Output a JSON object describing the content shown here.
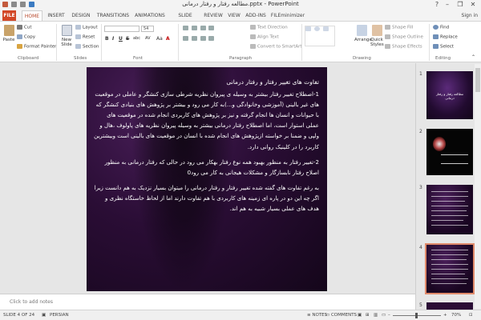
{
  "window": {
    "title": "مطالعه رفتار و رفتار درمانی.pptx - PowerPoint",
    "controls": {
      "help": "?",
      "minimize": "–",
      "restore": "❐",
      "close": "✕"
    }
  },
  "tabs": [
    "FILE",
    "HOME",
    "INSERT",
    "DESIGN",
    "TRANSITIONS",
    "ANIMATIONS",
    "SLIDE SHOW",
    "REVIEW",
    "VIEW",
    "ADD-INS",
    "FILEminimizer"
  ],
  "active_tab": "HOME",
  "signin": "Sign in",
  "ribbon": {
    "clipboard": {
      "paste": "Paste",
      "cut": "Cut",
      "copy": "Copy",
      "format_painter": "Format Painter",
      "label": "Clipboard"
    },
    "slides": {
      "new_slide_1": "New",
      "new_slide_2": "Slide",
      "layout": "Layout",
      "reset": "Reset",
      "section": "Section",
      "label": "Slides"
    },
    "font": {
      "name": "",
      "size": "54",
      "bold": "B",
      "italic": "I",
      "underline": "U",
      "strike": "S",
      "shadow": "abc",
      "spacing": "AV",
      "case": "Aa",
      "color": "A",
      "label": "Font"
    },
    "paragraph": {
      "text_direction": "Text Direction",
      "align_text": "Align Text",
      "smartart": "Convert to SmartArt",
      "label": "Paragraph"
    },
    "drawing": {
      "arrange": "Arrange",
      "quick_styles_1": "Quick",
      "quick_styles_2": "Styles",
      "shape_fill": "Shape Fill",
      "shape_outline": "Shape Outline",
      "shape_effects": "Shape Effects",
      "label": "Drawing"
    },
    "editing": {
      "find": "Find",
      "replace": "Replace",
      "select": "Select",
      "label": "Editing"
    }
  },
  "slide": {
    "heading": "تفاوت های تغییر رفتار و رفتار درمانی",
    "paragraphs": [
      "1-اصطلاح تغییر رفتار بیشتر به وسیله ی پیروان نظریه شرطی سازی کنشگر و عاملی در موقعیت های غیر بالینی (آموزشی وخانوادگی و...)به کار می رود و بیشتر بر پژوهش های بنیادی کنشگر که با حیوانات و انسان ها انجام گرفته و نیز بر پژوهش های کاربردی انجام شده در موقعیت های عملی استوار است، اما اصطلاح رفتار درمانی بیشتر به وسیله پیروان نظریه های پاولوف ،هال و ولپی و ضمنا بر خواسته ازپژوهش های انجام شده با انسان در موقعیت های بالینی است وبیشترین کاربرد را در کلینیک روانی دارد.",
      "2-تغییر رفتار به منظور بهبود همه نوع رفتار بهکار می رود در حالی که رفتار درمانی به منظور اصلاح رفتار نابسازگار و مشکلات هیجانی به کار می رود0",
      "به رغم تفاوت های گفته شده تغییر رفتار و رفتار درمانی را میتوان بسیار نزدیک به هم دانست زیرا اگر چه این دو در پاره ای زمینه های کاربردی با هم تفاوت دارند اما از لحاظ خاستگاه نظری و هدف های عملی بسیار شبیه به هم اند."
    ]
  },
  "thumbnails": [
    {
      "num": "1",
      "star": "★",
      "caption": "مطالعه رفتار و رفتار درمانی"
    },
    {
      "num": "2",
      "star": "★",
      "caption": ""
    },
    {
      "num": "3",
      "star": "★",
      "caption": ""
    },
    {
      "num": "4",
      "star": "★",
      "caption": ""
    },
    {
      "num": "5",
      "star": "",
      "caption": ""
    }
  ],
  "notes": {
    "placeholder": "Click to add notes"
  },
  "status": {
    "slide_pos": "SLIDE 4 OF 24",
    "language": "PERSIAN",
    "notes": "NOTES",
    "comments": "COMMENTS",
    "zoom": "70%"
  },
  "colors": {
    "file_tab": "#d24726",
    "accent": "#b7472a",
    "slide_bg": "#2a0d35"
  }
}
